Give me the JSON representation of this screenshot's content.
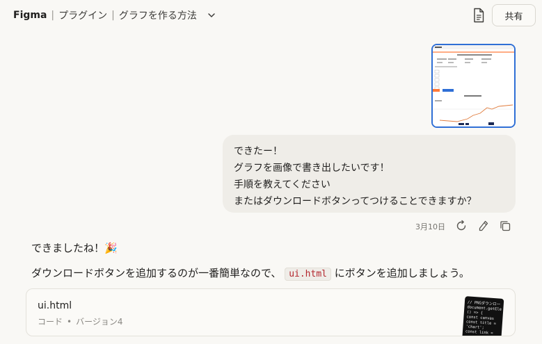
{
  "header": {
    "app": "Figma",
    "section": "プラグイン",
    "title": "グラフを作る方法",
    "share_label": "共有"
  },
  "user_message": {
    "lines": [
      "できたー！",
      "グラフを画像で書き出したいです！",
      "手順を教えてください",
      "またはダウンロードボタンってつけることできますか？"
    ],
    "date": "3月10日"
  },
  "assistant": {
    "line1": "できましたね！🎉",
    "line2_before": "ダウンロードボタンを追加するのが一番簡単なので、",
    "line2_code": "ui.html",
    "line2_after": "にボタンを追加しましょう。"
  },
  "artifact": {
    "title": "ui.html",
    "type": "コード",
    "version": "バージョン4",
    "preview_lines": [
      "// PNGダウンロー",
      "document.getEle",
      "() => {",
      "  const canvas",
      "  const title =",
      "'chart';",
      "  const link ="
    ]
  },
  "icons": {
    "chevron": "chevron-down-icon",
    "document": "document-icon",
    "retry": "retry-icon",
    "edit": "edit-icon",
    "copy": "copy-icon"
  }
}
